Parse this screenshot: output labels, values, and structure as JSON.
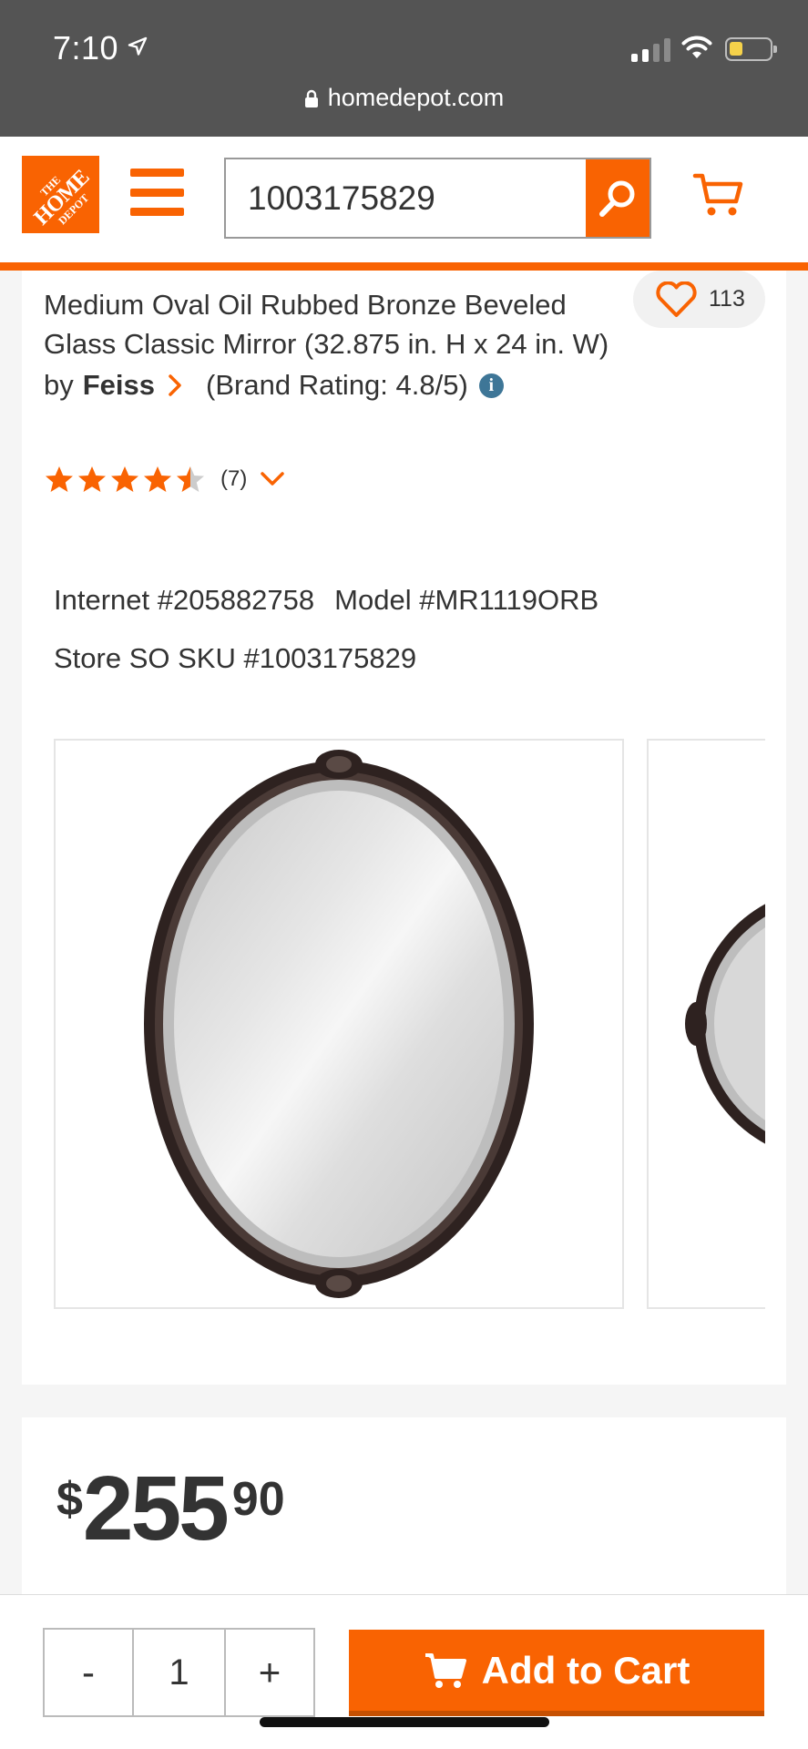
{
  "status_bar": {
    "time": "7:10",
    "url": "homedepot.com"
  },
  "header": {
    "logo": {
      "line1": "THE",
      "line2": "HOME",
      "line3": "DEPOT"
    },
    "search": {
      "value": "1003175829"
    }
  },
  "product": {
    "title": "Medium Oval Oil Rubbed Bronze Beveled Glass Classic Mirror (32.875 in. H x 24 in. W)",
    "favorite_count": "113",
    "by_label": "by",
    "brand": "Feiss",
    "brand_rating": "(Brand Rating: 4.8/5)",
    "rating": 4.5,
    "review_count": "(7)",
    "internet_number": "Internet #205882758",
    "model_number": "Model #MR1119ORB",
    "sku": "Store SO SKU #1003175829"
  },
  "price": {
    "currency": "$",
    "dollars": "255",
    "cents": "90"
  },
  "cart_bar": {
    "minus_label": "-",
    "quantity": "1",
    "plus_label": "+",
    "add_to_cart_label": "Add to Cart"
  },
  "colors": {
    "brand_orange": "#f96302",
    "star": "#f96302",
    "info_blue": "#3e7697",
    "status_bar_bg": "#545454"
  },
  "icons": [
    "location-arrow-icon",
    "signal-icon",
    "wifi-icon",
    "battery-icon",
    "lock-icon",
    "menu-icon",
    "search-icon",
    "cart-icon",
    "heart-icon",
    "chevron-right-icon",
    "info-icon",
    "star-icon",
    "chevron-down-icon"
  ]
}
